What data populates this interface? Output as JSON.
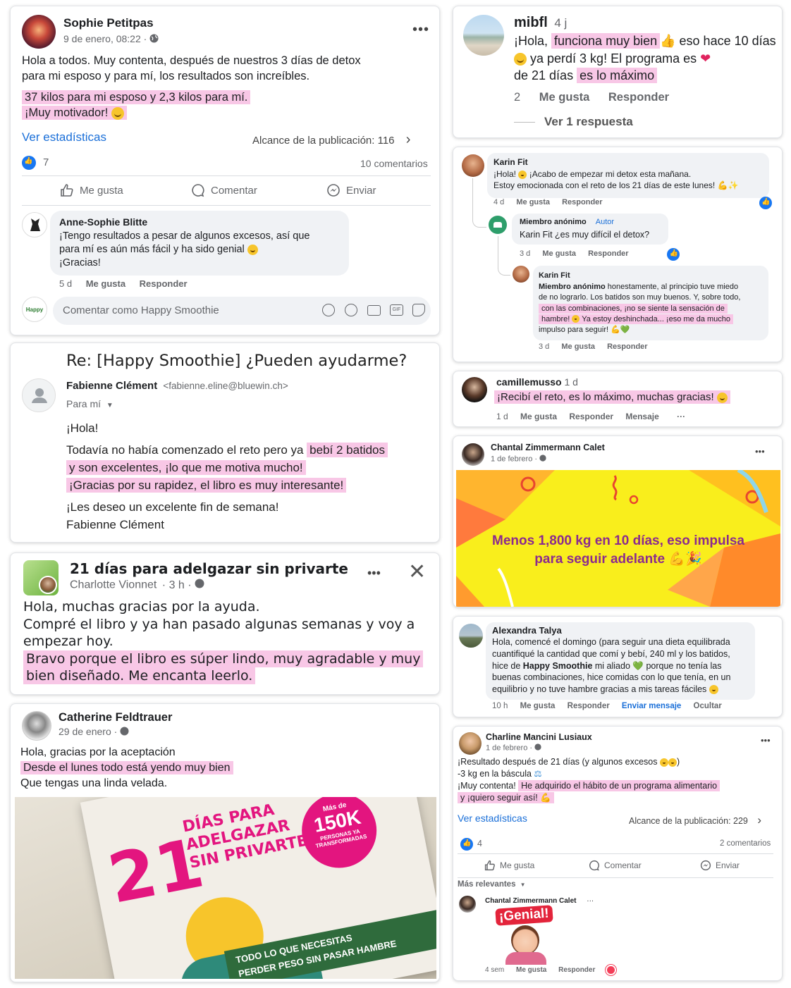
{
  "sophie": {
    "name": "Sophie Petitpas",
    "date": "9 de enero, 08:22 ·",
    "line1": "Hola a todos. Muy contenta, después de nuestros 3 días de detox",
    "line2": "para mi esposo y para mí, los resultados son increíbles.",
    "hl1": "37 kilos para mi esposo y 2,3 kilos para mí.",
    "hl2": "¡Muy motivador!",
    "stats_link": "Ver estadísticas",
    "reach": "Alcance de la publicación: 116",
    "likes": "7",
    "comments_count": "10 comentarios",
    "like_btn": "Me gusta",
    "comment_btn": "Comentar",
    "send_btn": "Enviar",
    "reply": {
      "name": "Anne-Sophie Blitte",
      "l1": "¡Tengo resultados a pesar de algunos excesos, así que",
      "l2": "para mí es aún más fácil y ha sido genial",
      "l3": "¡Gracias!",
      "time": "5 d",
      "like": "Me gusta",
      "respond": "Responder"
    },
    "input_placeholder": "Comentar como Happy Smoothie",
    "page_logo": "Happy"
  },
  "mibfl": {
    "name": "mibfl",
    "time": "4 j",
    "p1a": "¡Hola, ",
    "p1hl": "funciona muy bien",
    "p1b": " eso hace 10 días",
    "p2": " ya perdí 3 kg! El programa es ",
    "p3a": "de 21 días ",
    "p3hl": "es lo máximo",
    "count": "2",
    "like": "Me gusta",
    "respond": "Responder",
    "see_reply": "Ver 1 respuesta"
  },
  "karin": {
    "name": "Karin Fit",
    "l1": "¡Hola!",
    "l1b": " ¡Acabo de empezar mi detox esta mañana.",
    "l2": "Estoy emocionada con el reto de los 21 días de este lunes!",
    "time": "4 d",
    "like": "Me gusta",
    "respond": "Responder",
    "anon_name": "Miembro anónimo",
    "anon_badge": "Autor",
    "anon_text": "Karin Fit ¿es muy difícil el detox?",
    "anon_time": "3 d",
    "reply_name": "Karin Fit",
    "reply_bold": "Miembro anónimo",
    "reply_l1": " honestamente, al principio tuve miedo",
    "reply_l2": "de no lograrlo. Los batidos son muy buenos. Y, sobre todo,",
    "reply_hl1": "con las combinaciones, ¡no se siente la sensación de",
    "reply_hl2": "hambre!",
    "reply_hl3": "Ya estoy deshinchada... ¡eso me da mucho",
    "reply_hl4": "impulso para seguir!",
    "reply_time": "3 d"
  },
  "camille": {
    "name": "camillemusso",
    "time": "1 d",
    "text": "¡Recibí el reto, es lo máximo, muchas gracias!",
    "t": "1 d",
    "like": "Me gusta",
    "respond": "Responder",
    "message": "Mensaje",
    "more": "···"
  },
  "email": {
    "subject": "Re: [Happy Smoothie] ¿Pueden ayudarme?",
    "sender": "Fabienne Clément",
    "address": "<fabienne.eline@bluewin.ch>",
    "to": "Para mí",
    "greet": "¡Hola!",
    "l1a": "Todavía no había comenzado el reto pero ya ",
    "l1hl": "bebí 2 batidos",
    "l2hl": "y son excelentes, ¡lo que me motiva mucho!",
    "l3hl": "¡Gracias por su rapidez, el libro es muy interesante!",
    "l4": "¡Les deseo un excelente fin de semana!",
    "sign": "Fabienne Clément"
  },
  "chantal": {
    "name": "Chantal Zimmermann Calet",
    "date": "1 de febrero ·",
    "banner_l1": "Menos 1,800 kg en 10 días, eso impulsa",
    "banner_l2": "para seguir adelante"
  },
  "group": {
    "title": "21 días para adelgazar sin privarte",
    "author": "Charlotte Vionnet",
    "time": "· 3 h ·",
    "l1": "Hola, muchas gracias por la ayuda.",
    "l2": "Compré el libro y ya han pasado algunas semanas y voy a",
    "l3": "empezar hoy.",
    "hl1": "Bravo porque el libro es súper lindo, muy agradable y muy",
    "hl2": "bien diseñado. Me encanta leerlo."
  },
  "alexandra": {
    "name": "Alexandra Talya",
    "l1": "Hola, comencé el domingo (para seguir una dieta equilibrada",
    "l2": "cuantifiqué la cantidad que comí y bebí, 240 ml y los batidos,",
    "l3a": "hice de ",
    "l3b": "Happy Smoothie",
    "l3c": " mi aliado ",
    "l3d": " porque no tenía las",
    "l4": "buenas combinaciones, hice comidas con lo que tenía, en un",
    "l5": "equilibrio y no tuve hambre gracias a mis tareas fáciles",
    "time": "10 h",
    "like": "Me gusta",
    "respond": "Responder",
    "send_msg": "Enviar mensaje",
    "hide": "Ocultar"
  },
  "catherine": {
    "name": "Catherine Feldtrauer",
    "date": "29 de enero ·",
    "l1": "Hola, gracias por la aceptación",
    "hl": "Desde el lunes todo está yendo muy bien",
    "l3": "Que tengas una linda velada.",
    "book_num": "21",
    "book_t1": "DÍAS PARA",
    "book_t2": "ADELGAZAR",
    "book_t3": "SIN PRIVARTE",
    "badge1": "Más de",
    "badge2": "150K",
    "badge3": "PERSONAS YA",
    "badge4": "TRANSFORMADAS",
    "ribbon1": "TODO LO QUE NECESITAS",
    "ribbon2": "PERDER PESO SIN PASAR HAMBRE"
  },
  "charline": {
    "name": "Charline Mancini Lusiaux",
    "date": "1 de febrero ·",
    "l1": "¡Resultado después de 21 días (y algunos excesos",
    "l2": "-3 kg en la báscula",
    "l3a": "¡Muy contenta! ",
    "l3hl": "He adquirido el hábito de un programa alimentario",
    "l4hl": "y ¡quiero seguir así!",
    "stats_link": "Ver estadísticas",
    "reach": "Alcance de la publicación: 229",
    "likes": "4",
    "comments_count": "2 comentarios",
    "like_btn": "Me gusta",
    "comment_btn": "Comentar",
    "send_btn": "Enviar",
    "relevant": "Más relevantes",
    "reply_name": "Chantal Zimmermann Calet",
    "sticker": "¡Genial!",
    "reply_time": "4 sem",
    "reply_like": "Me gusta",
    "reply_respond": "Responder"
  }
}
